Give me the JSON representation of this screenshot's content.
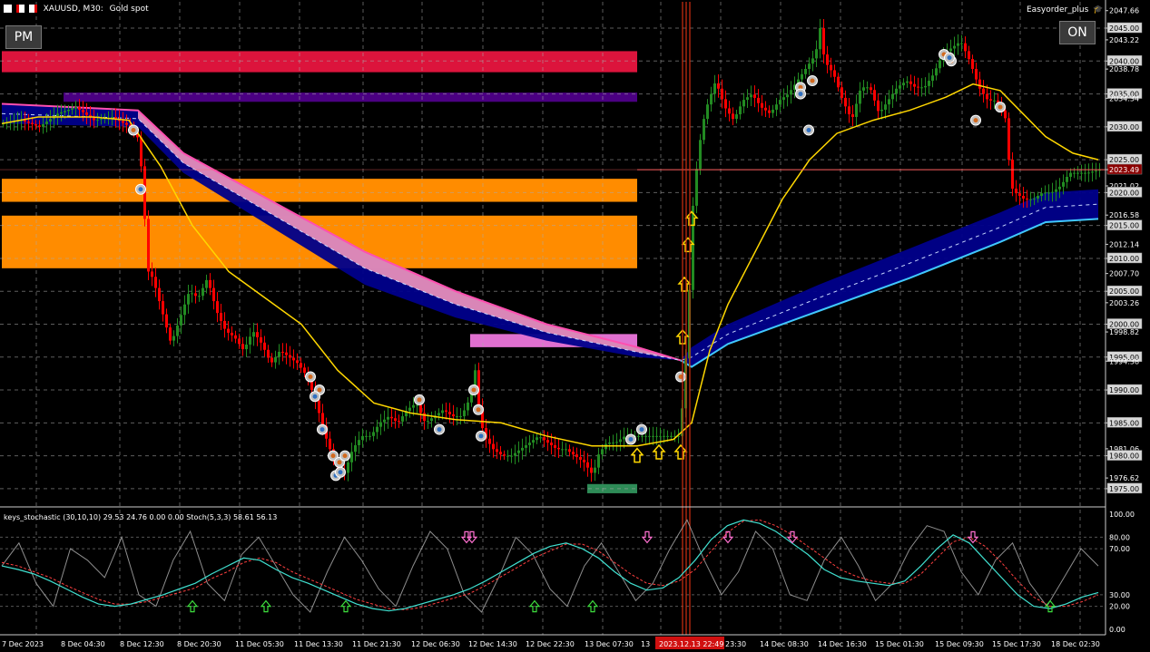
{
  "header": {
    "symbol": "XAUUSD, M30:",
    "description": "Gold spot",
    "ea_name": "Easyorder_plus"
  },
  "buttons": {
    "pm": "PM",
    "on": "ON"
  },
  "price_axis": {
    "labels": [
      "2047.66",
      "2045.00",
      "2043.22",
      "2040.00",
      "2038.78",
      "2035.00",
      "2034.34",
      "2030.00",
      "2025.00",
      "2023.49",
      "2021.02",
      "2020.00",
      "2016.58",
      "2015.00",
      "2012.14",
      "2010.00",
      "2007.70",
      "2005.00",
      "2003.26",
      "2000.00",
      "1998.82",
      "1995.00",
      "1994.38",
      "1990.00",
      "1985.00",
      "1981.06",
      "1980.00",
      "1976.62",
      "1975.00"
    ],
    "boxed": [
      "2045.00",
      "2040.00",
      "2035.00",
      "2030.00",
      "2025.00",
      "2023.49",
      "2020.00",
      "2015.00",
      "2010.00",
      "2005.00",
      "2000.00",
      "1995.00",
      "1990.00",
      "1985.00",
      "1980.00",
      "1975.00"
    ],
    "current": "2023.49"
  },
  "indicator": {
    "title": "keys_stochastic (30,10,10) 29.53 24.76 0.00 0.00 Stoch(5,3,3) 58.61 56.13",
    "levels": [
      "100.00",
      "80.00",
      "70.00",
      "30.00",
      "20.00",
      "0.00"
    ]
  },
  "time_axis": {
    "labels": [
      "7 Dec 2023",
      "8 Dec 04:30",
      "8 Dec 12:30",
      "8 Dec 20:30",
      "11 Dec 05:30",
      "11 Dec 13:30",
      "11 Dec 21:30",
      "12 Dec 06:30",
      "12 Dec 14:30",
      "12 Dec 22:30",
      "13 Dec 07:30",
      "13",
      "2023.12.13 22:49",
      "23:30",
      "14 Dec 08:30",
      "14 Dec 16:30",
      "15 Dec 01:30",
      "15 Dec 09:30",
      "15 Dec 17:30",
      "18 Dec 02:30"
    ],
    "highlight": "2023.12.13 22:49"
  },
  "colors": {
    "background": "#000000",
    "grid": "#aaaaaa",
    "bull": "#228b22",
    "bear": "#ff0000",
    "ma_yellow": "#ffd700",
    "cloud_blue": "#00008b",
    "cloud_pink": "#ff9ec0",
    "zone_red": "#dc143c",
    "zone_purple": "#4b0082",
    "zone_orange": "#ff8c00",
    "zone_pink": "#e070d0",
    "zone_green": "#2e8b57",
    "stoch_main": "#40e0d0",
    "stoch_signal": "#ff4040",
    "keys_line": "#b0b0b0"
  },
  "chart_data": {
    "type": "candlestick",
    "symbol": "XAUUSD",
    "timeframe": "M30",
    "ylim": [
      1972.5,
      2049
    ],
    "current_price": 2023.49,
    "close_path": [
      [
        0,
        2030.5
      ],
      [
        20,
        2031
      ],
      [
        40,
        2030
      ],
      [
        60,
        2032
      ],
      [
        80,
        2033
      ],
      [
        100,
        2031
      ],
      [
        120,
        2031.5
      ],
      [
        140,
        2030
      ],
      [
        150,
        2028
      ],
      [
        155,
        2018
      ],
      [
        160,
        2008
      ],
      [
        165,
        2007
      ],
      [
        175,
        2002
      ],
      [
        185,
        1997
      ],
      [
        195,
        2001
      ],
      [
        205,
        2005
      ],
      [
        215,
        2004
      ],
      [
        225,
        2007
      ],
      [
        235,
        2002
      ],
      [
        245,
        1999
      ],
      [
        255,
        1998
      ],
      [
        265,
        1996
      ],
      [
        275,
        1999
      ],
      [
        285,
        1997
      ],
      [
        295,
        1994
      ],
      [
        305,
        1996
      ],
      [
        315,
        1995
      ],
      [
        325,
        1994
      ],
      [
        335,
        1992
      ],
      [
        345,
        1988
      ],
      [
        355,
        1983
      ],
      [
        365,
        1979
      ],
      [
        375,
        1977
      ],
      [
        385,
        1981
      ],
      [
        395,
        1983
      ],
      [
        405,
        1983
      ],
      [
        415,
        1985
      ],
      [
        425,
        1986
      ],
      [
        435,
        1985
      ],
      [
        445,
        1987
      ],
      [
        455,
        1988
      ],
      [
        465,
        1985
      ],
      [
        475,
        1986
      ],
      [
        485,
        1987
      ],
      [
        495,
        1986
      ],
      [
        505,
        1986
      ],
      [
        515,
        1989
      ],
      [
        520,
        1993
      ],
      [
        525,
        1986
      ],
      [
        530,
        1983
      ],
      [
        540,
        1981
      ],
      [
        550,
        1980
      ],
      [
        560,
        1980
      ],
      [
        570,
        1981
      ],
      [
        580,
        1982
      ],
      [
        590,
        1983
      ],
      [
        600,
        1982
      ],
      [
        610,
        1981
      ],
      [
        620,
        1981
      ],
      [
        630,
        1980
      ],
      [
        640,
        1979
      ],
      [
        650,
        1977
      ],
      [
        655,
        1980
      ],
      [
        665,
        1982
      ],
      [
        675,
        1982
      ],
      [
        685,
        1983
      ],
      [
        695,
        1983
      ],
      [
        705,
        1983
      ],
      [
        715,
        1983
      ],
      [
        725,
        1983
      ],
      [
        735,
        1983
      ],
      [
        745,
        1983
      ],
      [
        750,
        1990
      ],
      [
        755,
        2002
      ],
      [
        760,
        2018
      ],
      [
        765,
        2025
      ],
      [
        770,
        2030
      ],
      [
        775,
        2033
      ],
      [
        780,
        2035
      ],
      [
        785,
        2037
      ],
      [
        795,
        2033
      ],
      [
        805,
        2031
      ],
      [
        815,
        2034
      ],
      [
        825,
        2035
      ],
      [
        835,
        2033
      ],
      [
        845,
        2032
      ],
      [
        855,
        2034
      ],
      [
        865,
        2035
      ],
      [
        875,
        2037
      ],
      [
        885,
        2039
      ],
      [
        895,
        2041
      ],
      [
        900,
        2045
      ],
      [
        905,
        2040
      ],
      [
        915,
        2038
      ],
      [
        925,
        2034
      ],
      [
        935,
        2031
      ],
      [
        945,
        2036
      ],
      [
        955,
        2036
      ],
      [
        965,
        2032
      ],
      [
        975,
        2034
      ],
      [
        985,
        2036
      ],
      [
        995,
        2037
      ],
      [
        1005,
        2036
      ],
      [
        1015,
        2036
      ],
      [
        1025,
        2038
      ],
      [
        1035,
        2041
      ],
      [
        1045,
        2042
      ],
      [
        1055,
        2043
      ],
      [
        1065,
        2040
      ],
      [
        1075,
        2036
      ],
      [
        1085,
        2034
      ],
      [
        1095,
        2034
      ],
      [
        1105,
        2031
      ],
      [
        1110,
        2021
      ],
      [
        1115,
        2020
      ],
      [
        1125,
        2019
      ],
      [
        1135,
        2019
      ],
      [
        1145,
        2020
      ],
      [
        1155,
        2020
      ],
      [
        1165,
        2021
      ],
      [
        1175,
        2023
      ],
      [
        1185,
        2023
      ],
      [
        1195,
        2023
      ],
      [
        1208,
        2023.49
      ]
    ],
    "moving_average": [
      [
        0,
        2030.5
      ],
      [
        40,
        2031.5
      ],
      [
        100,
        2031.5
      ],
      [
        140,
        2031
      ],
      [
        175,
        2024
      ],
      [
        210,
        2015
      ],
      [
        250,
        2008
      ],
      [
        290,
        2004
      ],
      [
        330,
        2000
      ],
      [
        370,
        1993
      ],
      [
        410,
        1988
      ],
      [
        450,
        1986.5
      ],
      [
        500,
        1985.5
      ],
      [
        550,
        1985
      ],
      [
        600,
        1983
      ],
      [
        650,
        1981.5
      ],
      [
        700,
        1981.5
      ],
      [
        740,
        1982.5
      ],
      [
        760,
        1985
      ],
      [
        780,
        1996
      ],
      [
        800,
        2003
      ],
      [
        830,
        2011
      ],
      [
        860,
        2019
      ],
      [
        890,
        2025
      ],
      [
        920,
        2029
      ],
      [
        960,
        2031
      ],
      [
        1000,
        2032.5
      ],
      [
        1040,
        2034.5
      ],
      [
        1070,
        2036.5
      ],
      [
        1100,
        2035.5
      ],
      [
        1125,
        2032
      ],
      [
        1150,
        2028.5
      ],
      [
        1180,
        2026
      ],
      [
        1208,
        2025
      ]
    ],
    "cloud_upper": [
      [
        0,
        2033.5
      ],
      [
        150,
        2032.5
      ],
      [
        200,
        2026
      ],
      [
        300,
        2018.5
      ],
      [
        400,
        2011
      ],
      [
        500,
        2005
      ],
      [
        600,
        2000
      ],
      [
        700,
        1996.5
      ],
      [
        748,
        1994.5
      ],
      [
        760,
        1996.5
      ],
      [
        800,
        2000
      ],
      [
        900,
        2006
      ],
      [
        1000,
        2011.5
      ],
      [
        1100,
        2017
      ],
      [
        1150,
        2020
      ],
      [
        1208,
        2020.5
      ]
    ],
    "cloud_lower": [
      [
        0,
        2030.5
      ],
      [
        150,
        2030
      ],
      [
        200,
        2023
      ],
      [
        300,
        2014.5
      ],
      [
        400,
        2006
      ],
      [
        500,
        2001
      ],
      [
        600,
        1997.5
      ],
      [
        700,
        1995
      ],
      [
        748,
        1994.5
      ],
      [
        760,
        1993.5
      ],
      [
        800,
        1997
      ],
      [
        900,
        2002
      ],
      [
        1000,
        2007
      ],
      [
        1100,
        2012.5
      ],
      [
        1150,
        2015.5
      ],
      [
        1208,
        2016
      ]
    ],
    "zones": [
      {
        "color": "red",
        "from": 2038.3,
        "to": 2041.5
      },
      {
        "color": "purple",
        "from": 2033.8,
        "to": 2035.2
      },
      {
        "color": "orange",
        "from": 2018.6,
        "to": 2022.1
      },
      {
        "color": "orange",
        "from": 2008.5,
        "to": 2016.5
      },
      {
        "color": "pink",
        "from": 1996.5,
        "to": 1998.5
      },
      {
        "color": "green",
        "from": 1974.3,
        "to": 1975.7
      }
    ],
    "signals_up_arrows": [
      [
        700,
        1980
      ],
      [
        724,
        1980.5
      ],
      [
        748,
        1980.5
      ],
      [
        750,
        1998
      ],
      [
        752,
        2006
      ],
      [
        756,
        2012
      ],
      [
        760,
        2016
      ]
    ],
    "signals_down_circles": [
      [
        145,
        2029.5
      ],
      [
        340,
        1992
      ],
      [
        350,
        1990
      ],
      [
        365,
        1980
      ],
      [
        372,
        1979
      ],
      [
        378,
        1980
      ],
      [
        460,
        1988.5
      ],
      [
        520,
        1990
      ],
      [
        525,
        1987
      ],
      [
        748,
        1992
      ],
      [
        880,
        2036
      ],
      [
        893,
        2037
      ],
      [
        1038,
        2041
      ],
      [
        1046,
        2040
      ],
      [
        1073,
        2031
      ],
      [
        1100,
        2033
      ]
    ],
    "signals_up_circles": [
      [
        153,
        2020.5
      ],
      [
        345,
        1989
      ],
      [
        353,
        1984
      ],
      [
        368,
        1977
      ],
      [
        373,
        1977.5
      ],
      [
        482,
        1984
      ],
      [
        528,
        1983
      ],
      [
        693,
        1982.5
      ],
      [
        705,
        1984
      ],
      [
        880,
        2035
      ],
      [
        889,
        2029.5
      ],
      [
        1044,
        2040.5
      ]
    ],
    "stochastic": {
      "levels": [
        100,
        80,
        70,
        30,
        20,
        0
      ],
      "keys_values": [
        55,
        75,
        40,
        20,
        70,
        60,
        45,
        80,
        30,
        20,
        60,
        85,
        40,
        25,
        65,
        80,
        55,
        30,
        15,
        50,
        80,
        60,
        35,
        20,
        55,
        85,
        70,
        30,
        15,
        45,
        80,
        65,
        35,
        20,
        55,
        75,
        50,
        25,
        40,
        70,
        95,
        60,
        30,
        50,
        85,
        70,
        30,
        25,
        60,
        80,
        55,
        25,
        40,
        70,
        90,
        85,
        50,
        30,
        60,
        75,
        40,
        20,
        45,
        70,
        55
      ],
      "main_values": [
        55,
        52,
        48,
        42,
        35,
        28,
        22,
        20,
        22,
        26,
        30,
        35,
        40,
        48,
        55,
        62,
        60,
        52,
        45,
        40,
        34,
        28,
        22,
        18,
        16,
        18,
        22,
        26,
        30,
        35,
        42,
        50,
        58,
        66,
        72,
        75,
        70,
        62,
        50,
        40,
        34,
        36,
        45,
        60,
        78,
        90,
        95,
        92,
        85,
        75,
        65,
        52,
        45,
        42,
        40,
        38,
        42,
        55,
        70,
        82,
        75,
        60,
        45,
        30,
        20,
        18,
        22,
        28,
        32
      ],
      "signal_values": [
        58,
        55,
        50,
        45,
        38,
        32,
        26,
        22,
        22,
        24,
        28,
        32,
        36,
        44,
        50,
        58,
        62,
        58,
        50,
        44,
        38,
        32,
        26,
        22,
        18,
        17,
        19,
        23,
        27,
        31,
        38,
        46,
        54,
        62,
        68,
        74,
        74,
        68,
        58,
        48,
        40,
        38,
        42,
        52,
        68,
        84,
        94,
        95,
        90,
        82,
        72,
        62,
        52,
        46,
        42,
        40,
        40,
        48,
        62,
        76,
        80,
        72,
        58,
        42,
        28,
        20,
        20,
        24,
        30
      ]
    }
  }
}
